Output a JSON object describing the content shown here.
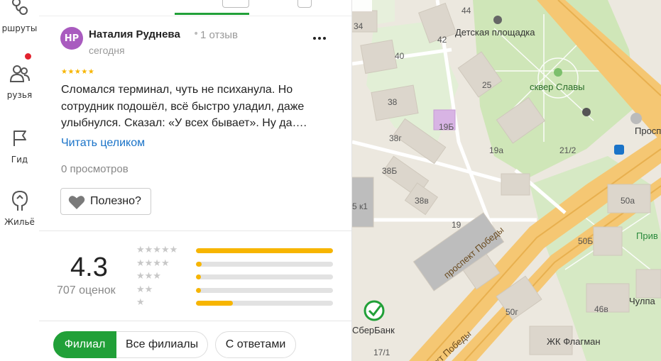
{
  "nav": {
    "items": [
      {
        "label": "ршруты",
        "icon": "routes-icon"
      },
      {
        "label": "рузья",
        "icon": "friends-icon"
      },
      {
        "label": "Гид",
        "icon": "flag-icon"
      },
      {
        "label": "Жильё",
        "icon": "house-icon"
      }
    ]
  },
  "review": {
    "avatar_initials": "НР",
    "author": "Наталия Руднева",
    "reviews_count": "1 отзыв",
    "date": "сегодня",
    "rating_stars": 5,
    "text_lines": [
      "Сломался терминал, чуть не психанула. Но",
      "сотрудник подошёл, всё быстро уладил, даже",
      "улыбнулся. Сказал: «У всех бывает». Ну да…."
    ],
    "read_more": "Читать целиком",
    "views": "0 просмотров",
    "useful_label": "Полезно?"
  },
  "summary": {
    "rating": "4.3",
    "count_label": "707 оценок",
    "distribution": [
      {
        "stars": 5,
        "share": 1.0
      },
      {
        "stars": 4,
        "share": 0.04
      },
      {
        "stars": 3,
        "share": 0.03
      },
      {
        "stars": 2,
        "share": 0.03
      },
      {
        "stars": 1,
        "share": 0.27
      }
    ]
  },
  "filters": {
    "branch": "Филиал",
    "all_branches": "Все филиалы",
    "with_answers": "С ответами"
  },
  "map": {
    "labels": {
      "playground": "Детская площадка",
      "square": "сквер Славы",
      "prospect": "Просп",
      "pobedy1": "проспект Победы",
      "pobedy2": "ект Победы",
      "sberbank": "СберБанк",
      "zhk": "ЖК Флагман",
      "chulpan": "Чулпа",
      "priv": "Прив",
      "n44": "44",
      "n34": "34",
      "n42": "42",
      "n40": "40",
      "n25": "25",
      "n38": "38",
      "n19b": "19Б",
      "n38g": "38г",
      "n38b": "38Б",
      "n19a": "19а",
      "n21": "21/2",
      "n5k1": "5 к1",
      "n38v": "38в",
      "n19": "19",
      "n50a": "50а",
      "n50b": "50Б",
      "n46v": "46в",
      "n50g": "50г",
      "n17": "17/1"
    }
  },
  "colors": {
    "accent": "#21a038",
    "star": "#f7b500",
    "link": "#1a73c8",
    "avatar": "#a95bbf"
  }
}
